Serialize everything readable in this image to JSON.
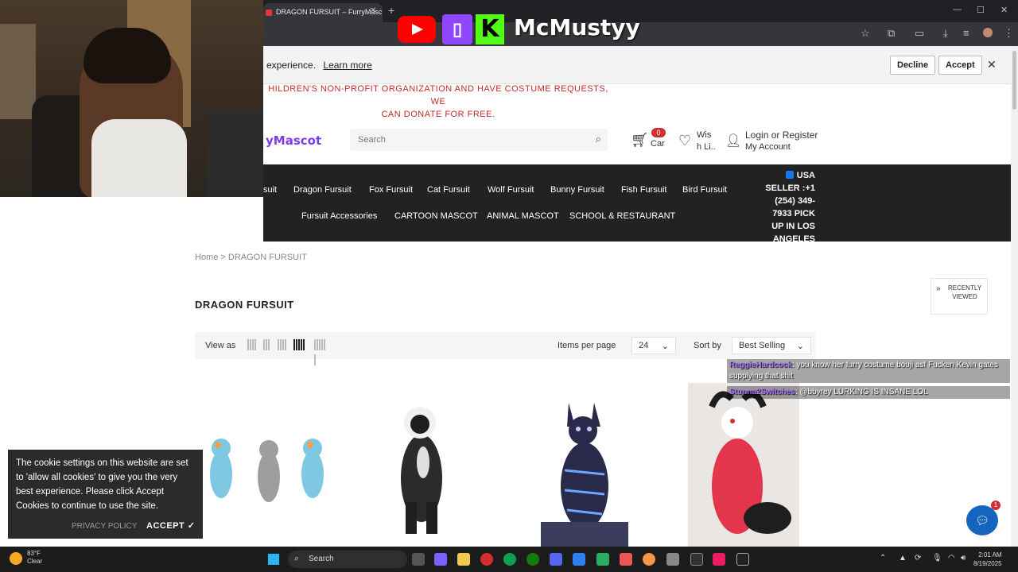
{
  "browser": {
    "tab_title": "DRAGON FURSUIT – FurryMasc",
    "tab_close": "✕",
    "new_tab": "+",
    "win_min": "—",
    "win_max": "☐",
    "win_close": "✕"
  },
  "overlay": {
    "streamer_name": "McMustyy",
    "kick_letter": "K"
  },
  "cookie_banner": {
    "text": "experience.",
    "learn_more": "Learn more",
    "decline": "Decline",
    "accept": "Accept",
    "close": "✕"
  },
  "announcement": {
    "line1": "",
    "line2": "HILDREN'S NON-PROFIT ORGANIZATION AND HAVE COSTUME REQUESTS, WE",
    "line3": "CAN DONATE FOR FREE."
  },
  "header": {
    "logo": "yMascot",
    "search_placeholder": "Search",
    "cart_count": "0",
    "cart_label": "Car",
    "wishlist_label_1": "Wis",
    "wishlist_label_2": "h Li..",
    "login_label": "Login or Register",
    "account_label": "My Account"
  },
  "nav": {
    "row1": [
      "suit",
      "Dragon Fursuit",
      "Fox Fursuit",
      "Cat Fursuit",
      "Wolf Fursuit",
      "Bunny Fursuit",
      "Fish Fursuit",
      "Bird Fursuit"
    ],
    "row2": [
      "Fursuit Accessories",
      "CARTOON MASCOT",
      "ANIMAL MASCOT",
      "SCHOOL & RESTAURANT"
    ],
    "contact": {
      "l1": "USA",
      "l2": "SELLER :+1",
      "l3": "(254) 349-",
      "l4": "7933 PICK",
      "l5": "UP IN LOS",
      "l6": "ANGELES"
    }
  },
  "breadcrumb": {
    "home": "Home",
    "sep": ">",
    "current": "DRAGON FURSUIT"
  },
  "recently_viewed": {
    "l1": "RECENTLY",
    "l2": "VIEWED"
  },
  "collection": {
    "title": "DRAGON FURSUIT",
    "view_as": "View as",
    "items_per_page_label": "Items per page",
    "items_per_page_value": "24",
    "sort_label": "Sort by",
    "sort_value": "Best Selling"
  },
  "chat": [
    {
      "user": "ReggieHardcock",
      "text": ": you know her furry costume bouji asf Fucken Kevin gates supplying that shit"
    },
    {
      "user": "Stunna2Switches",
      "text": ": @bbyrey LURKING IS INSANE LOL"
    }
  ],
  "cookie_popup": {
    "text": "The cookie settings on this website are set to 'allow all cookies' to give you the very best experience. Please click Accept Cookies to continue to use the site.",
    "privacy": "PRIVACY POLICY",
    "accept": "ACCEPT ✓"
  },
  "chat_widget_badge": "1",
  "taskbar": {
    "temp": "83°F",
    "condition": "Clear",
    "search": "Search",
    "time": "2:01 AM",
    "date": "8/19/2025"
  },
  "colors": {
    "nav_bg": "#222222",
    "announce_red": "#c62828",
    "logo_purple": "#7c3aed"
  }
}
